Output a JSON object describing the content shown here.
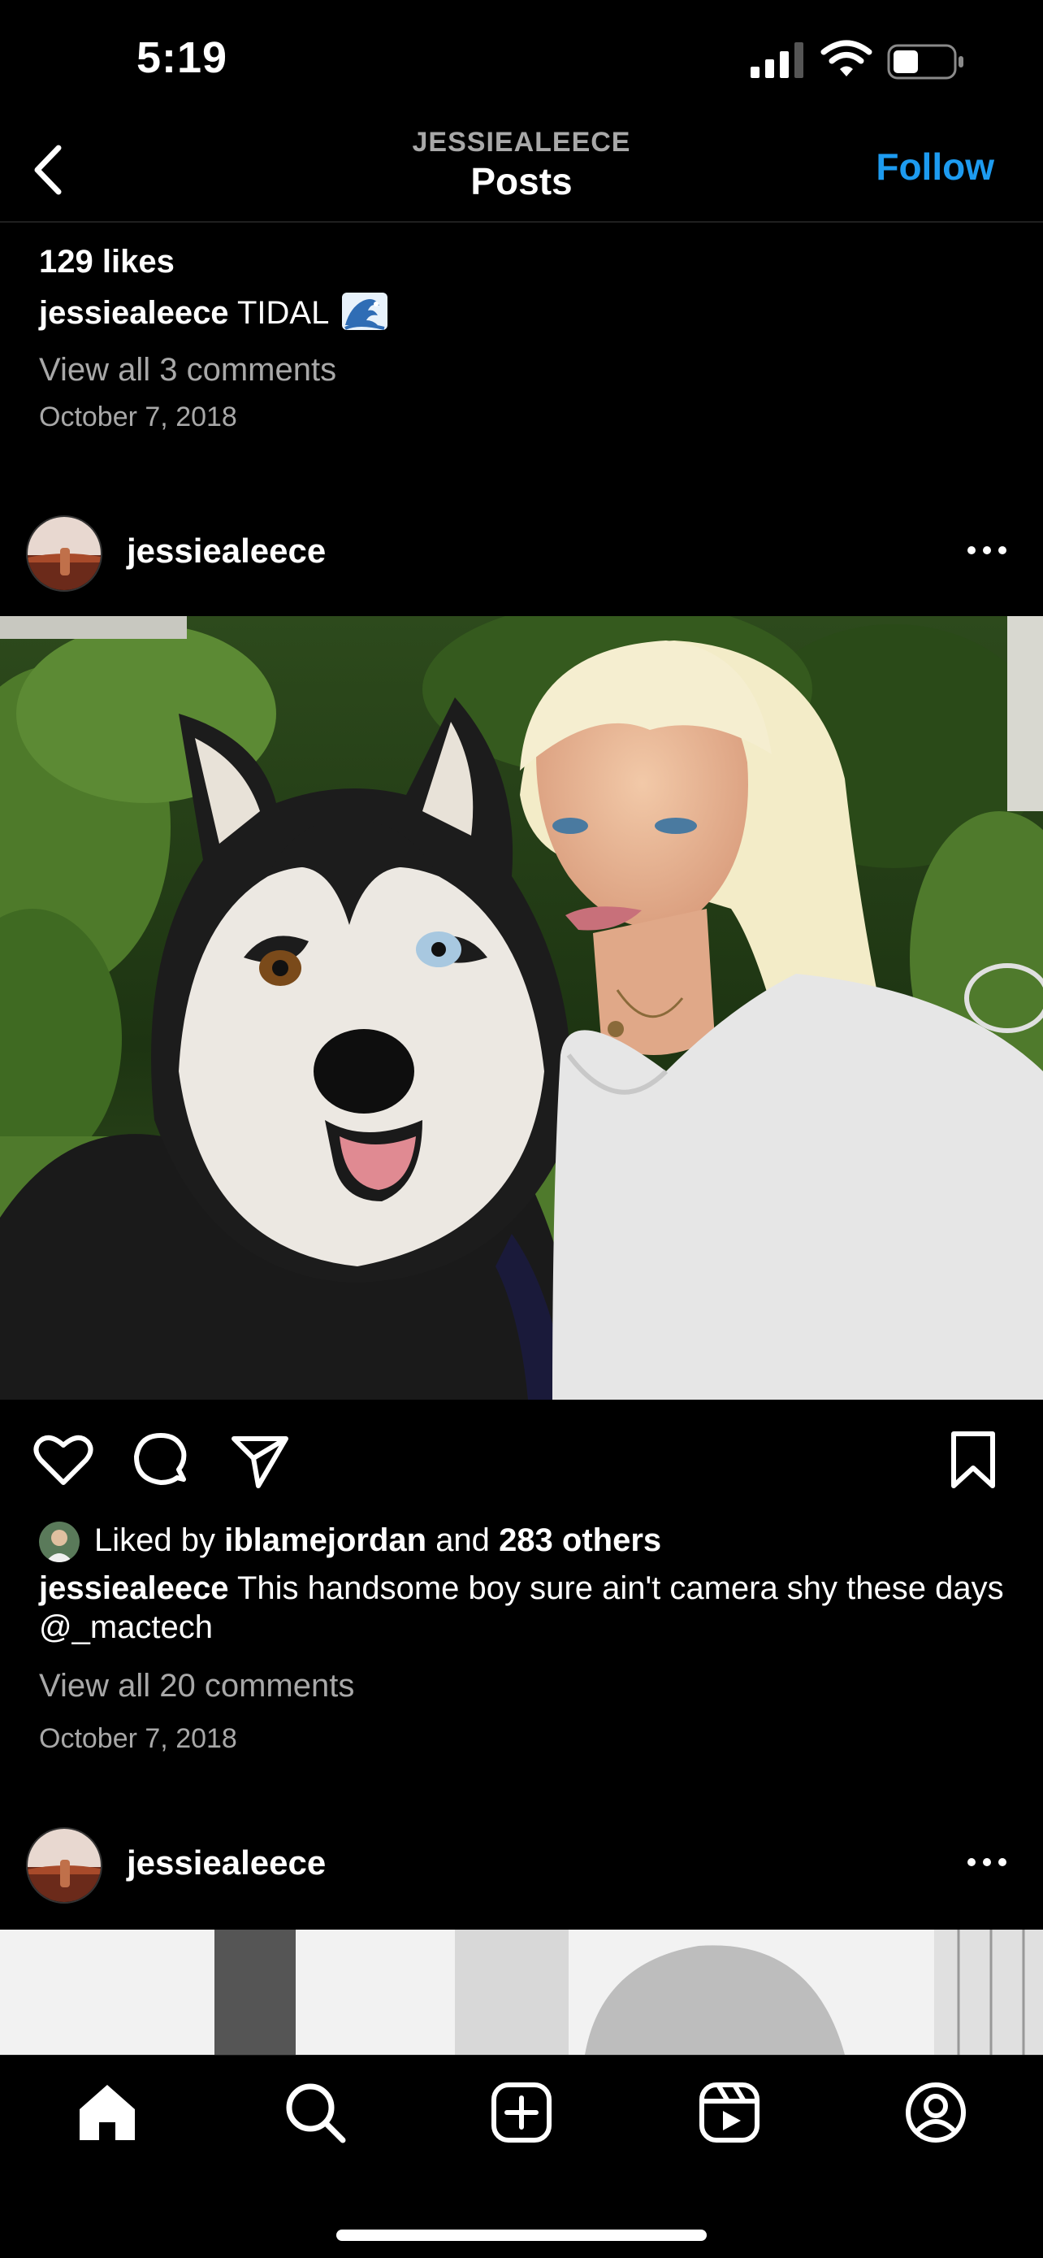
{
  "status_bar": {
    "time": "5:19"
  },
  "header": {
    "subtitle": "JESSIEALEECE",
    "title": "Posts",
    "follow_label": "Follow"
  },
  "previous_post": {
    "likes": "129 likes",
    "username": "jessiealeece",
    "caption": "TIDAL",
    "caption_emoji": "wave-emoji",
    "comments_link": "View all 3 comments",
    "date": "October 7, 2018"
  },
  "post": {
    "username": "jessiealeece",
    "liked_by_prefix": "Liked by",
    "liked_by_user": "iblamejordan",
    "liked_by_and": "and",
    "liked_by_others": "283 others",
    "caption_user": "jessiealeece",
    "caption_text": "This handsome boy sure ain't camera shy these days @_mactech",
    "comments_link": "View all 20 comments",
    "date": "October 7, 2018"
  },
  "next_post": {
    "username": "jessiealeece"
  },
  "icons": {
    "back": "chevron-left-icon",
    "more": "more-horizontal-icon",
    "like": "heart-icon",
    "comment": "comment-icon",
    "share": "send-icon",
    "save": "bookmark-icon",
    "tabs": [
      "home-icon",
      "search-icon",
      "create-icon",
      "reels-icon",
      "profile-icon"
    ]
  },
  "colors": {
    "background": "#000000",
    "accent": "#1d9bf0",
    "secondary_text": "#a8a8a8"
  }
}
